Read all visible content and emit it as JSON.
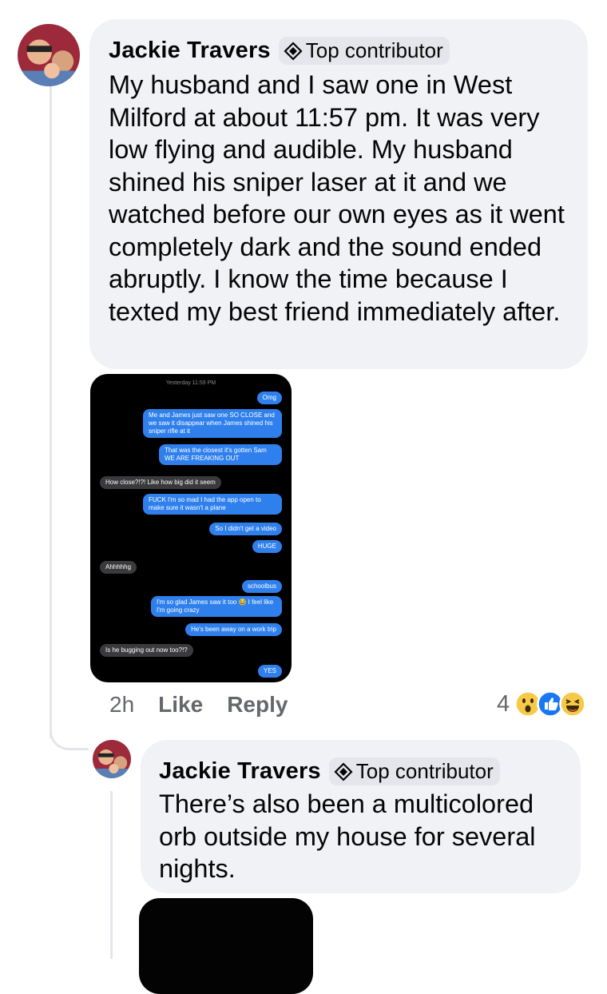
{
  "comment": {
    "author": "Jackie Travers",
    "badge": "Top contributor",
    "text": "My husband and I saw one in West Milford at about 11:57 pm. It was very low flying and audible. My husband shined his sniper laser at it and we watched before our own eyes as it went completely dark and the sound ended abruptly. I know the time because I texted my best friend immediately after.",
    "screenshot": {
      "timestamp": "Yesterday 11:59 PM",
      "messages": [
        {
          "side": "sent",
          "text": "Omg"
        },
        {
          "side": "sent",
          "text": "Me and James just saw one SO CLOSE and we saw it disappear when James shined his sniper rifle at it"
        },
        {
          "side": "sent",
          "text": "That was the closest it's gotten Sam WE ARE FREAKING OUT"
        },
        {
          "side": "recv",
          "text": "How close?!?! Like how big did it seem"
        },
        {
          "side": "sent",
          "text": "FUCK I'm so mad I had the app open to make sure it wasn't a plane"
        },
        {
          "side": "sent",
          "text": "So I didn't get a video"
        },
        {
          "side": "sent",
          "text": "HUGE"
        },
        {
          "side": "recv",
          "text": "Ahhhhhg"
        },
        {
          "side": "sent",
          "text": "schoolbus"
        },
        {
          "side": "sent",
          "text": "I'm so glad James saw it too 😂 I feel like I'm going crazy"
        },
        {
          "side": "sent",
          "text": "He's been away on a work trip"
        },
        {
          "side": "recv",
          "text": "Is he bugging out now too?!?"
        },
        {
          "side": "sent",
          "text": "YES"
        }
      ]
    },
    "actions": {
      "time": "2h",
      "like": "Like",
      "reply": "Reply"
    },
    "reactions": {
      "count": "4",
      "icons": [
        "wow-icon",
        "like-icon",
        "haha-icon"
      ]
    }
  },
  "reply": {
    "author": "Jackie Travers",
    "badge": "Top contributor",
    "text": "There’s also been a multicolored orb outside my house for several nights."
  },
  "colors": {
    "bubble": "#f0f2f5",
    "sent_message": "#2f80ed",
    "received_message": "#3a3a3c",
    "secondary_text": "#65676b"
  }
}
